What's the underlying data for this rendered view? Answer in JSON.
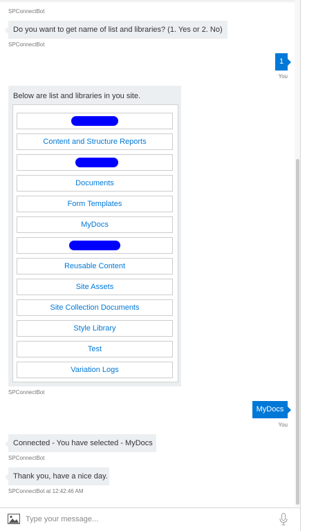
{
  "bot_name": "SPConnectBot",
  "messages": {
    "m1": {
      "sender": "SPConnectBot",
      "text": "Do you want to get name of list and libraries? (1. Yes or 2. No)"
    },
    "m1_footer": "SPConnectBot",
    "m2": {
      "sender": "You",
      "text": "1"
    },
    "m3": {
      "text": "Below are list and libraries in you site.",
      "buttons": [
        "",
        "Content and Structure Reports",
        "",
        "Documents",
        "Form Templates",
        "MyDocs",
        "",
        "Reusable Content",
        "Site Assets",
        "Site Collection Documents",
        "Style Library",
        "Test",
        "Variation Logs"
      ],
      "footer": "SPConnectBot"
    },
    "m4": {
      "sender": "You",
      "text": "MyDocs"
    },
    "m5": {
      "text": "Connected - You have selected - MyDocs",
      "footer": "SPConnectBot"
    },
    "m6": {
      "text": "Thank you, have a nice day.",
      "footer": "SPConnectBot at 12:42:46 AM"
    }
  },
  "input": {
    "placeholder": "Type your message...",
    "value": ""
  },
  "icons": {
    "attach": "image-icon",
    "mic": "microphone-icon"
  },
  "colors": {
    "accent": "#0078d7",
    "bot_bubble": "#eceff1",
    "redaction": "#0000ff"
  }
}
